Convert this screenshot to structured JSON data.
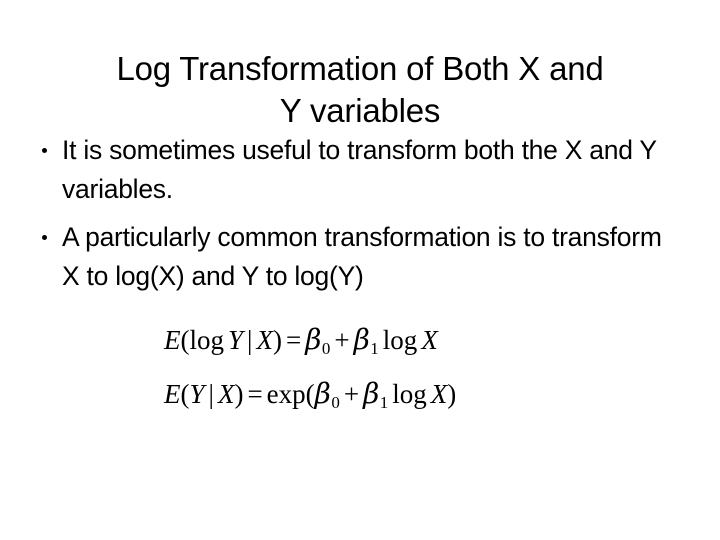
{
  "slide": {
    "background_color": "#ffffff",
    "text_color": "#000000",
    "title": "Log Transformation of Both X and\nY variables",
    "bullets": [
      "It is sometimes useful to transform both the X and Y variables.",
      "A particularly common transformation is to transform X to log(X) and Y to log(Y)"
    ],
    "equations": [
      {
        "plain": "E(log Y | X) = β0 + β1 log X",
        "parts": {
          "lhs_fn": "E",
          "open": "(",
          "log": "log",
          "y": "Y",
          "bar": "|",
          "x": "X",
          "close": ")",
          "eq": "=",
          "beta": "β",
          "sub0": "0",
          "plus": "+",
          "sub1": "1",
          "log2": "log",
          "x2": "X"
        }
      },
      {
        "plain": "E(Y | X) = exp(β0 + β1 log X)",
        "parts": {
          "lhs_fn": "E",
          "open": "(",
          "y": "Y",
          "bar": "|",
          "x": "X",
          "close": ")",
          "eq": "=",
          "exp": "exp",
          "open2": "(",
          "beta": "β",
          "sub0": "0",
          "plus": "+",
          "sub1": "1",
          "log": "log",
          "x2": "X",
          "close2": ")"
        }
      }
    ]
  }
}
